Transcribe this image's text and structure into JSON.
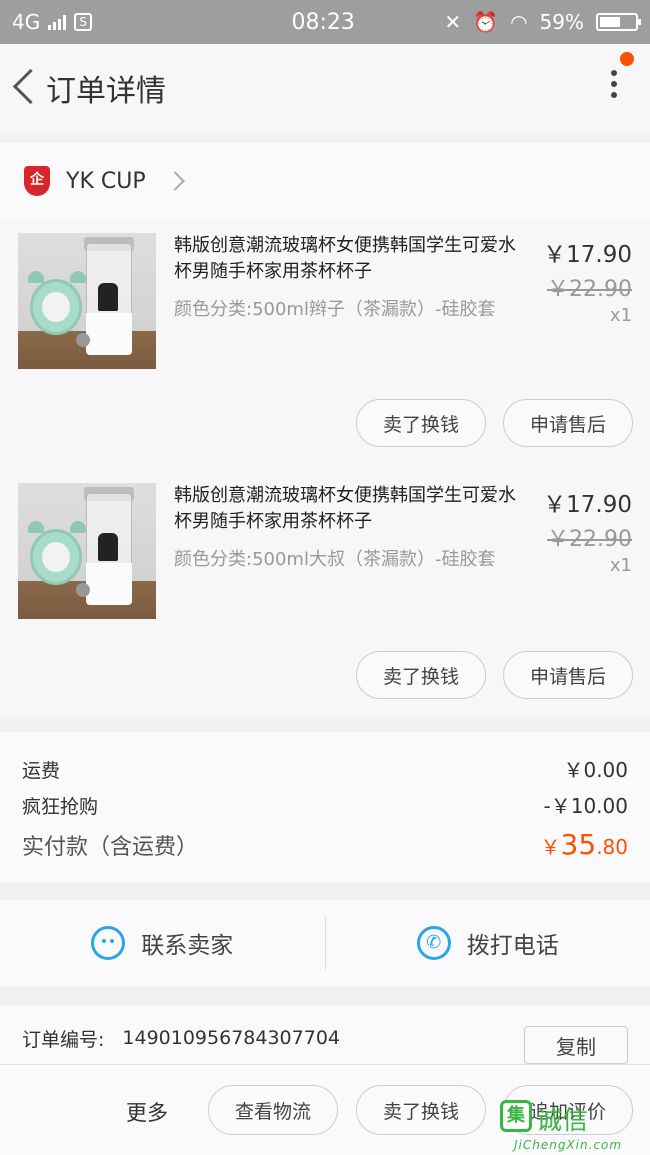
{
  "status_bar": {
    "network": "4G",
    "sim_badge": "S",
    "time": "08:23",
    "battery": "59%",
    "battery_level": 0.59
  },
  "header": {
    "title": "订单详情"
  },
  "shop": {
    "logo_text": "企",
    "name": "YK CUP"
  },
  "items": [
    {
      "title": "韩版创意潮流玻璃杯女便携韩国学生可爱水杯男随手杯家用茶杯杯子",
      "spec": "颜色分类:500ml辫子（茶漏款）-硅胶套",
      "price": "￥17.90",
      "original_price": "￥22.90",
      "quantity": "x1",
      "action_sell": "卖了换钱",
      "action_aftersale": "申请售后"
    },
    {
      "title": "韩版创意潮流玻璃杯女便携韩国学生可爱水杯男随手杯家用茶杯杯子",
      "spec": "颜色分类:500ml大叔（茶漏款）-硅胶套",
      "price": "￥17.90",
      "original_price": "￥22.90",
      "quantity": "x1",
      "action_sell": "卖了换钱",
      "action_aftersale": "申请售后"
    }
  ],
  "summary": {
    "shipping_label": "运费",
    "shipping_value": "￥0.00",
    "discount_label": "疯狂抢购",
    "discount_value": "-￥10.00",
    "total_label": "实付款（含运费）",
    "total_currency": "￥",
    "total_int": "35",
    "total_dec": ".80"
  },
  "contact": {
    "seller_label": "联系卖家",
    "phone_label": "拨打电话"
  },
  "order": {
    "label": "订单编号:",
    "number": "149010956784307704",
    "copy_label": "复制"
  },
  "bottom_bar": {
    "more_label": "更多",
    "logistics_label": "查看物流",
    "sell_label": "卖了换钱",
    "review_label": "追加评价"
  },
  "watermark": {
    "logo_char": "集",
    "text": "诚信",
    "subtext": "JiChengXin.com"
  },
  "colors": {
    "accent": "#ff5000",
    "link_blue": "#29a5e8",
    "watermark_green": "#3bb544"
  }
}
